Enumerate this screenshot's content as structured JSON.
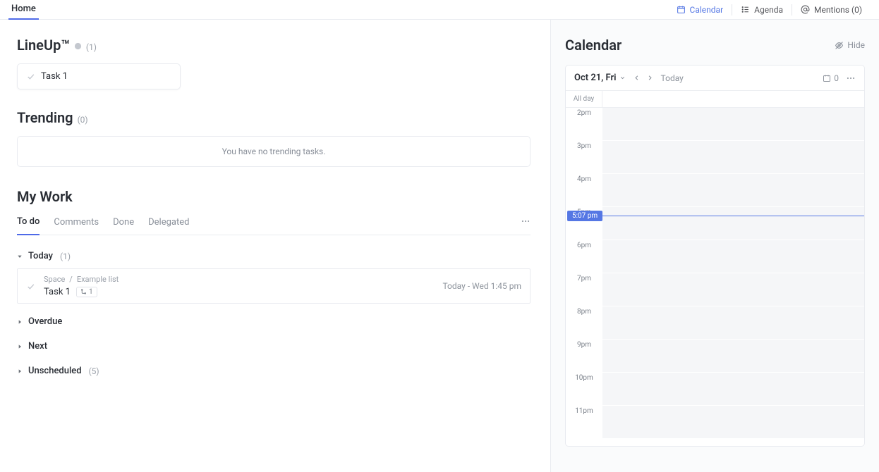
{
  "topbar": {
    "home_label": "Home",
    "calendar_label": "Calendar",
    "agenda_label": "Agenda",
    "mentions_label": "Mentions (0)"
  },
  "lineup": {
    "title": "LineUp™",
    "count": "(1)",
    "task1_label": "Task 1"
  },
  "trending": {
    "title": "Trending",
    "count": "(0)",
    "empty_message": "You have no trending tasks."
  },
  "mywork": {
    "title": "My Work",
    "tabs": {
      "todo": "To do",
      "comments": "Comments",
      "done": "Done",
      "delegated": "Delegated"
    },
    "groups": {
      "today_label": "Today",
      "today_count": "(1)",
      "overdue_label": "Overdue",
      "next_label": "Next",
      "unscheduled_label": "Unscheduled",
      "unscheduled_count": "(5)"
    },
    "task": {
      "space": "Space",
      "separator": "/",
      "list": "Example list",
      "name": "Task 1",
      "subtasks": "1",
      "due": "Today - Wed 1:45 pm"
    }
  },
  "calendar": {
    "title": "Calendar",
    "hide_label": "Hide",
    "date_label": "Oct 21, Fri",
    "today_label": "Today",
    "event_count": "0",
    "allday_label": "All day",
    "now_label": "5:07 pm",
    "hours": [
      "2pm",
      "3pm",
      "4pm",
      "5pm",
      "6pm",
      "7pm",
      "8pm",
      "9pm",
      "10pm",
      "11pm"
    ]
  }
}
